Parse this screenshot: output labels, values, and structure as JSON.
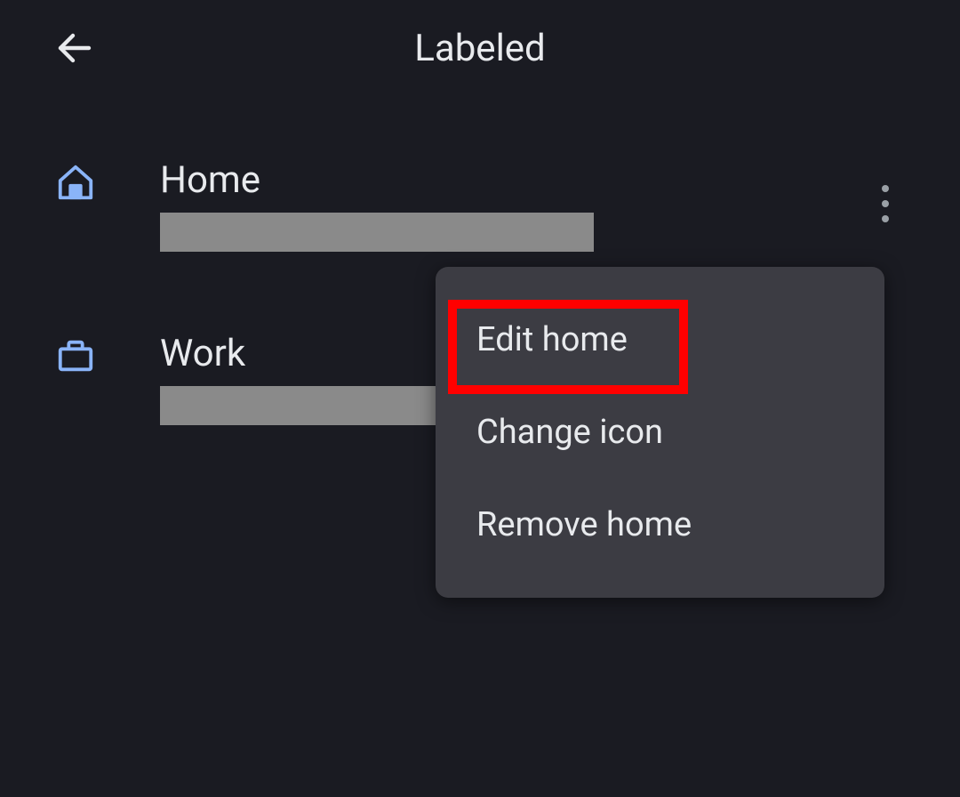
{
  "header": {
    "title": "Labeled"
  },
  "items": [
    {
      "label": "Home",
      "icon": "home"
    },
    {
      "label": "Work",
      "icon": "briefcase"
    }
  ],
  "menu": {
    "edit": "Edit home",
    "change_icon": "Change icon",
    "remove": "Remove home"
  }
}
